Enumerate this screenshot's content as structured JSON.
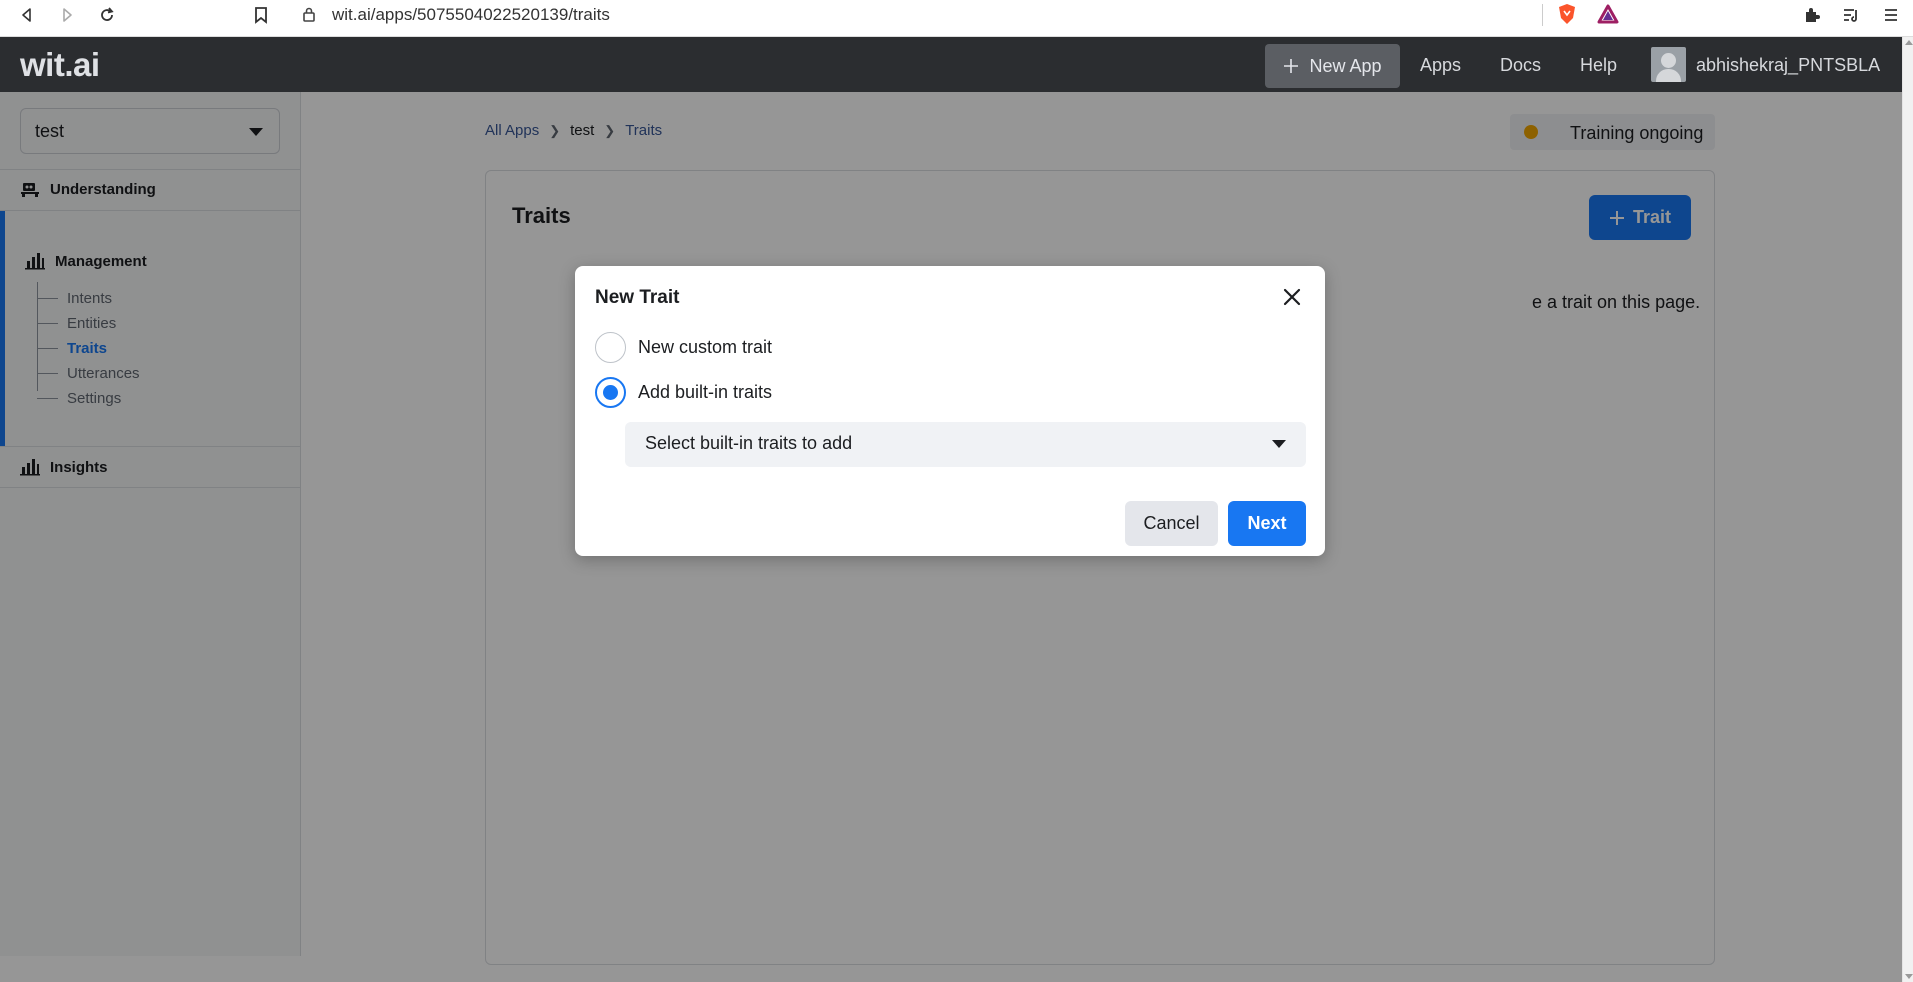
{
  "browser": {
    "url": "wit.ai/apps/5075504022520139/traits",
    "icons": [
      "back-icon",
      "forward-icon",
      "reload-icon",
      "bookmark-icon",
      "lock-icon",
      "brave-shield-icon",
      "brave-rewards-icon",
      "extensions-icon",
      "reading-list-icon",
      "menu-icon"
    ]
  },
  "header": {
    "logo": "wit.ai",
    "new_app_label": "New App",
    "nav": [
      "Apps",
      "Docs",
      "Help"
    ],
    "username": "abhishekraj_PNTSBLA"
  },
  "sidebar": {
    "app_name": "test",
    "sections": {
      "understanding": "Understanding",
      "management": "Management",
      "insights": "Insights"
    },
    "management_items": [
      {
        "label": "Intents",
        "active": false
      },
      {
        "label": "Entities",
        "active": false
      },
      {
        "label": "Traits",
        "active": true
      },
      {
        "label": "Utterances",
        "active": false
      },
      {
        "label": "Settings",
        "active": false
      }
    ]
  },
  "breadcrumb": [
    "All Apps",
    "test",
    "Traits"
  ],
  "status": {
    "label": "Training ongoing",
    "color": "#f0a500"
  },
  "card": {
    "title": "Traits",
    "add_button_label": "Trait",
    "hint_visible": "e a trait on this page."
  },
  "modal": {
    "title": "New Trait",
    "options": [
      {
        "label": "New custom trait",
        "checked": false
      },
      {
        "label": "Add built-in traits",
        "checked": true
      }
    ],
    "select_placeholder": "Select built-in traits to add",
    "cancel_label": "Cancel",
    "next_label": "Next"
  },
  "colors": {
    "accent": "#1877f2",
    "header_bg": "#2b2d30",
    "status_dot": "#f0a500"
  }
}
